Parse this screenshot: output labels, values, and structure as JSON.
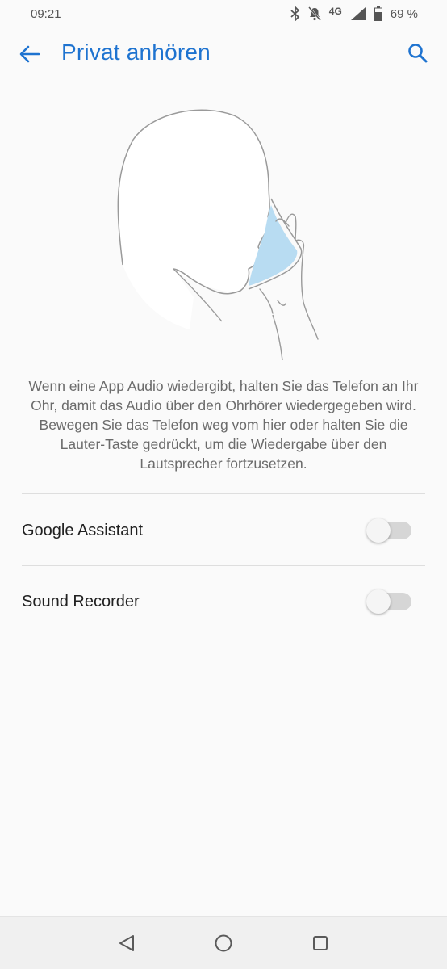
{
  "status_bar": {
    "time": "09:21",
    "network": "4G",
    "battery": "69 %",
    "icons": [
      "bluetooth-icon",
      "bell-off-icon",
      "signal-icon",
      "battery-icon"
    ]
  },
  "header": {
    "title": "Privat anhören",
    "back_icon": "arrow-back-icon",
    "search_icon": "search-icon"
  },
  "description": "Wenn eine App Audio wiedergibt, halten Sie das Telefon an Ihr Ohr, damit das Audio über den Ohrhörer wiedergegeben wird. Bewegen Sie das Telefon weg vom hier oder halten Sie die Lauter-Taste gedrückt, um die Wiedergabe über den Lautsprecher fortzusetzen.",
  "settings": [
    {
      "label": "Google Assistant",
      "enabled": false
    },
    {
      "label": "Sound Recorder",
      "enabled": false
    }
  ],
  "nav_bar": {
    "icons": [
      "nav-back-icon",
      "nav-home-icon",
      "nav-recents-icon"
    ]
  },
  "colors": {
    "accent": "#1e73d0",
    "phone_screen": "#b8dcf2"
  }
}
